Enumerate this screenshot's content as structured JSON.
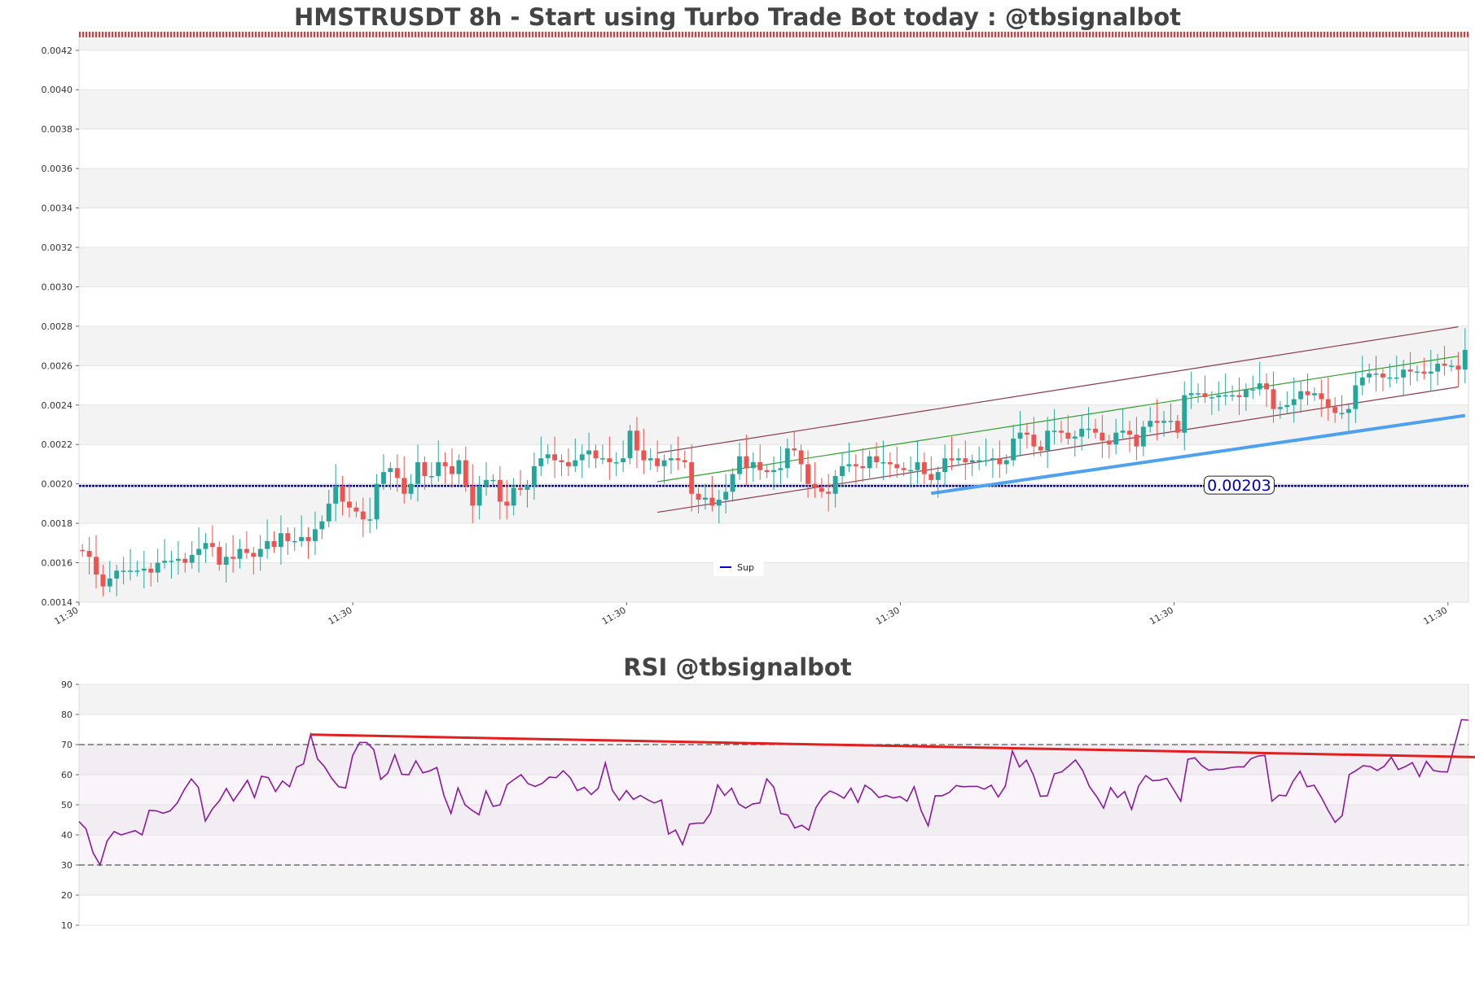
{
  "colors": {
    "up": "#26a69a",
    "down": "#ef5350",
    "support_line": "#0000cc",
    "channel": "#8b3a4a",
    "mid_channel": "#2ca02c",
    "trend": "#4ea1ef",
    "rsi": "#8b1a9b",
    "rsi_trend": "#e02020",
    "band": "#f3f3f3",
    "marker": "#cc2222"
  },
  "chart_data": [
    {
      "type": "candlestick",
      "title": "HMSTRUSDT 8h - Start using Turbo Trade Bot today : @tbsignalbot",
      "ylim": [
        0.0014,
        0.00429
      ],
      "yticks": [
        "0.0014",
        "0.0016",
        "0.0018",
        "0.0020",
        "0.0022",
        "0.0024",
        "0.0026",
        "0.0028",
        "0.0030",
        "0.0032",
        "0.0034",
        "0.0036",
        "0.0038",
        "0.0040",
        "0.0042"
      ],
      "ytick_values": [
        0.0014,
        0.0016,
        0.0018,
        0.002,
        0.0022,
        0.0024,
        0.0026,
        0.0028,
        0.003,
        0.0032,
        0.0034,
        0.0036,
        0.0038,
        0.004,
        0.0042
      ],
      "xticks": [
        "11:30",
        "11:30",
        "11:30",
        "11:30",
        "11:30",
        "11:30"
      ],
      "xtick_index": [
        0,
        40,
        80,
        120,
        160,
        200
      ],
      "support": {
        "name": "Sup",
        "value": 0.00199,
        "label": "0.00203",
        "label_at": 169
      },
      "top_marker_value": 0.00428,
      "closes": [
        0.00166,
        0.00163,
        0.00154,
        0.00148,
        0.00152,
        0.00156,
        0.00156,
        0.00156,
        0.00156,
        0.00157,
        0.00155,
        0.0016,
        0.00161,
        0.00161,
        0.00162,
        0.0016,
        0.00164,
        0.00167,
        0.0017,
        0.00168,
        0.00159,
        0.00163,
        0.00162,
        0.00167,
        0.00165,
        0.00163,
        0.00167,
        0.00171,
        0.00168,
        0.00175,
        0.00171,
        0.00171,
        0.00173,
        0.00171,
        0.00177,
        0.00181,
        0.0019,
        0.00199,
        0.00191,
        0.00188,
        0.00186,
        0.00182,
        0.00182,
        0.002,
        0.00206,
        0.00208,
        0.00203,
        0.00195,
        0.002,
        0.00211,
        0.00204,
        0.00204,
        0.00211,
        0.00209,
        0.00205,
        0.00212,
        0.00199,
        0.00189,
        0.00199,
        0.00202,
        0.00202,
        0.00191,
        0.00189,
        0.00198,
        0.00197,
        0.00199,
        0.00209,
        0.00213,
        0.00215,
        0.00212,
        0.00211,
        0.00209,
        0.00212,
        0.00215,
        0.00217,
        0.00213,
        0.00213,
        0.00211,
        0.00211,
        0.00213,
        0.00227,
        0.00217,
        0.00212,
        0.00213,
        0.00209,
        0.00212,
        0.00213,
        0.00212,
        0.00211,
        0.00195,
        0.00192,
        0.00193,
        0.00189,
        0.00192,
        0.00196,
        0.00205,
        0.00214,
        0.00208,
        0.00211,
        0.00207,
        0.00206,
        0.00207,
        0.00208,
        0.00218,
        0.00217,
        0.0021,
        0.002,
        0.00198,
        0.00196,
        0.00195,
        0.00204,
        0.00209,
        0.0021,
        0.00209,
        0.00208,
        0.00214,
        0.00211,
        0.00211,
        0.0021,
        0.00208,
        0.00207,
        0.00207,
        0.00211,
        0.00205,
        0.00202,
        0.00206,
        0.00213,
        0.00212,
        0.00213,
        0.00211,
        0.00212,
        0.00212,
        0.00212,
        0.00213,
        0.0021,
        0.00212,
        0.00223,
        0.00226,
        0.00225,
        0.00219,
        0.00217,
        0.00227,
        0.00227,
        0.00226,
        0.00223,
        0.00224,
        0.00228,
        0.00228,
        0.00226,
        0.00222,
        0.0022,
        0.00226,
        0.00227,
        0.00225,
        0.00219,
        0.00229,
        0.00232,
        0.00231,
        0.00232,
        0.00232,
        0.00226,
        0.00245,
        0.00246,
        0.00246,
        0.00244,
        0.00244,
        0.00245,
        0.00245,
        0.00245,
        0.00244,
        0.00248,
        0.00248,
        0.00251,
        0.00248,
        0.00238,
        0.00239,
        0.0024,
        0.00243,
        0.00247,
        0.00245,
        0.00246,
        0.00243,
        0.00239,
        0.00236,
        0.00236,
        0.00238,
        0.0025,
        0.00254,
        0.00256,
        0.00256,
        0.00254,
        0.00254,
        0.00254,
        0.00258,
        0.00257,
        0.00257,
        0.00256,
        0.00257,
        0.00261,
        0.0026,
        0.0026,
        0.00258,
        0.00268,
        0.00281,
        0.00282
      ],
      "channel_upper": [
        [
          84,
          0.002157
        ],
        [
          201,
          0.002797
        ]
      ],
      "channel_mid": [
        [
          84,
          0.002011
        ],
        [
          201,
          0.002648
        ]
      ],
      "channel_lower": [
        [
          84,
          0.001856
        ],
        [
          201,
          0.002492
        ]
      ],
      "trend_line": [
        [
          124,
          0.001952
        ],
        [
          202,
          0.002347
        ]
      ],
      "n_candles": 203
    },
    {
      "type": "line",
      "title": "RSI @tbsignalbot",
      "ylim": [
        10,
        90
      ],
      "yticks": [
        "10",
        "20",
        "30",
        "40",
        "50",
        "60",
        "70",
        "80",
        "90"
      ],
      "ytick_values": [
        10,
        20,
        30,
        40,
        50,
        60,
        70,
        80,
        90
      ],
      "levels": [
        30,
        70
      ],
      "values": [
        44.4,
        42.0,
        34.1,
        30.0,
        38.0,
        41.1,
        40.0,
        40.7,
        41.4,
        40.0,
        48.2,
        48.0,
        47.2,
        48.0,
        50.6,
        55.0,
        58.6,
        55.8,
        44.6,
        48.6,
        51.3,
        55.4,
        51.3,
        54.6,
        58.1,
        52.4,
        59.5,
        59.0,
        54.4,
        57.9,
        56.0,
        62.5,
        63.6,
        73.3,
        65.2,
        62.6,
        58.8,
        56.0,
        55.6,
        66.4,
        70.7,
        70.7,
        68.3,
        58.4,
        60.5,
        66.6,
        60.1,
        60.0,
        64.6,
        60.6,
        61.3,
        62.4,
        53.1,
        47.1,
        55.6,
        50.0,
        48.2,
        46.7,
        54.6,
        49.5,
        50.0,
        56.7,
        58.4,
        60.0,
        57.0,
        56.1,
        57.1,
        59.2,
        59.0,
        61.3,
        59.0,
        54.7,
        55.8,
        53.4,
        55.5,
        63.9,
        54.8,
        51.5,
        54.7,
        51.8,
        53.1,
        51.7,
        50.6,
        51.6,
        40.3,
        41.6,
        36.8,
        43.6,
        43.9,
        43.9,
        47.3,
        56.6,
        53.1,
        55.5,
        50.3,
        48.9,
        50.3,
        50.6,
        58.6,
        55.9,
        47.1,
        46.6,
        42.3,
        43.2,
        41.6,
        49.0,
        52.6,
        54.6,
        53.6,
        52.2,
        55.5,
        50.8,
        56.5,
        54.9,
        52.4,
        53.1,
        52.3,
        52.7,
        51.2,
        56.0,
        48.1,
        43.0,
        53.0,
        53.0,
        54.1,
        56.4,
        56.0,
        56.1,
        56.1,
        55.2,
        56.5,
        52.6,
        56.2,
        67.9,
        62.6,
        64.8,
        59.9,
        52.8,
        53.0,
        60.3,
        60.9,
        62.8,
        64.9,
        61.5,
        56.0,
        52.8,
        48.9,
        55.7,
        52.4,
        54.4,
        48.5,
        56.3,
        59.7,
        58.0,
        58.2,
        58.8,
        55.0,
        51.2,
        65.1,
        65.6,
        63.0,
        61.5,
        61.8,
        61.8,
        62.3,
        62.6,
        62.6,
        65.3,
        66.2,
        66.4,
        51.2,
        53.2,
        53.0,
        57.8,
        61.1,
        56.0,
        56.5,
        52.6,
        48.1,
        44.2,
        46.4,
        60.0,
        61.4,
        63.0,
        62.7,
        61.4,
        62.8,
        65.8,
        61.7,
        62.7,
        64.0,
        59.4,
        64.4,
        61.4,
        61.0,
        60.9,
        69.6,
        78.3,
        78.1
      ],
      "trend_line": [
        [
          33,
          73.3
        ],
        [
          202,
          65.7
        ]
      ]
    }
  ]
}
